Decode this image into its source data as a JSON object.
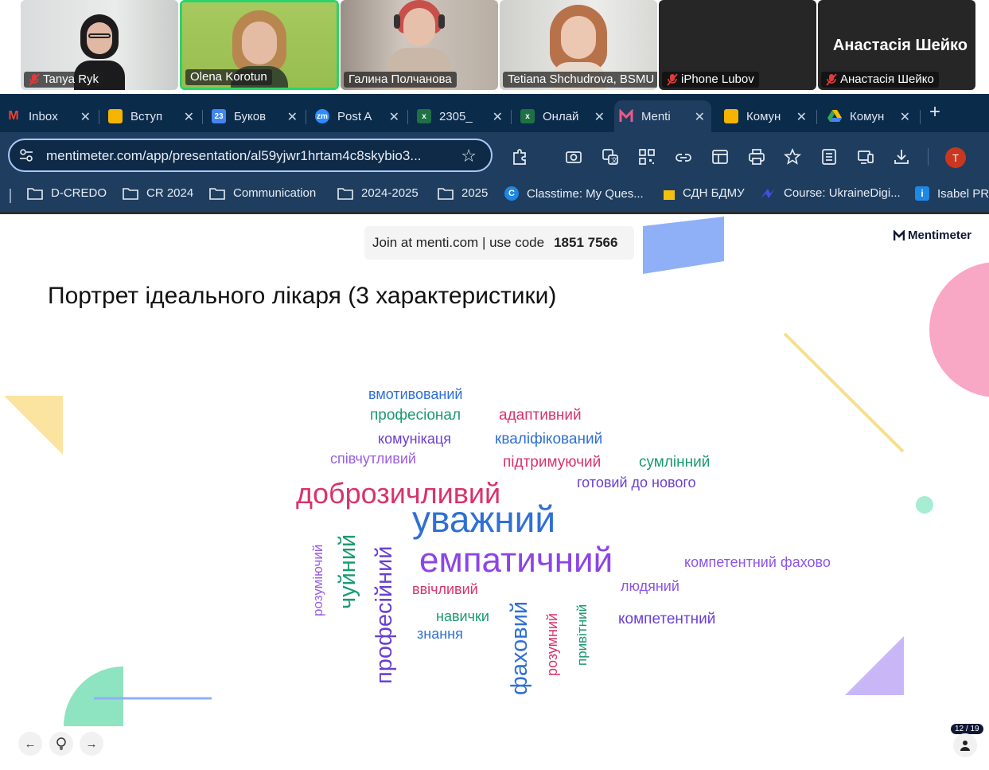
{
  "participants": [
    {
      "name": "Tanya Ryk",
      "muted": true
    },
    {
      "name": "Olena Korotun",
      "muted": false,
      "speaking": true
    },
    {
      "name": "Галина Полчанова",
      "muted": false
    },
    {
      "name": "Tetiana Shchudrova, BSMU",
      "muted": false
    },
    {
      "name": "iPhone Lubov",
      "muted": true
    },
    {
      "name": "Анастасія Шейко",
      "muted": true
    }
  ],
  "featured_name": "Анастасія Шейко",
  "tabs": [
    {
      "label": "Inbox",
      "icon": "gmail-icon",
      "color": "#ea4335"
    },
    {
      "label": "Вступ",
      "icon": "slides-icon",
      "color": "#f4b400"
    },
    {
      "label": "Буков",
      "icon": "calendar-icon",
      "color": "#4285f4"
    },
    {
      "label": "Post A",
      "icon": "zoom-icon",
      "color": "#2d8cff"
    },
    {
      "label": "2305_",
      "icon": "excel-icon",
      "color": "#1e7145"
    },
    {
      "label": "Онлай",
      "icon": "excel-icon",
      "color": "#1e7145"
    },
    {
      "label": "Menti",
      "icon": "mentimeter-icon",
      "color": "#e85c8a"
    },
    {
      "label": "Комун",
      "icon": "slides-icon",
      "color": "#f4b400"
    },
    {
      "label": "Комун",
      "icon": "drive-icon",
      "color": "#34a853"
    }
  ],
  "active_tab": 6,
  "address": {
    "url": "mentimeter.com/app/presentation/al59yjwr1hrtam4c8skybio3..."
  },
  "profile_initial": "T",
  "bookmarks": [
    {
      "label": "D-CREDO",
      "icon": "folder-icon"
    },
    {
      "label": "CR 2024",
      "icon": "folder-icon"
    },
    {
      "label": "Communication",
      "icon": "folder-icon"
    },
    {
      "label": "2024-2025",
      "icon": "folder-icon"
    },
    {
      "label": "2025",
      "icon": "folder-icon"
    },
    {
      "label": "Classtime: My Ques...",
      "icon": "classtime-icon"
    },
    {
      "label": "СДН БДМУ",
      "icon": "sticky-note-icon"
    },
    {
      "label": "Course: UkraineDigi...",
      "icon": "course-icon"
    },
    {
      "label": "Isabel PRO",
      "icon": "isabel-icon"
    }
  ],
  "slide": {
    "join_text": "Join at menti.com | use code",
    "join_code": "1851 7566",
    "brand": "Mentimeter",
    "title": "Портрет ідеального лікаря (3 характеристики)",
    "slide_counter": "12 / 19"
  },
  "word_cloud": [
    {
      "text": "вмотивований",
      "color": "#2f6fd6"
    },
    {
      "text": "професіонал",
      "color": "#1a9a72"
    },
    {
      "text": "адаптивний",
      "color": "#d9336a"
    },
    {
      "text": "комунікаця",
      "color": "#6a3fd2"
    },
    {
      "text": "кваліфікований",
      "color": "#2f6fd6"
    },
    {
      "text": "співчутливий",
      "color": "#9a5ee6"
    },
    {
      "text": "підтримуючий",
      "color": "#d9336a"
    },
    {
      "text": "сумлінний",
      "color": "#1a9a72"
    },
    {
      "text": "готовий до нового",
      "color": "#6a3fd2"
    },
    {
      "text": "доброзичливий",
      "color": "#d9336a"
    },
    {
      "text": "уважний",
      "color": "#2f6fd6"
    },
    {
      "text": "емпатичний",
      "color": "#8b45e6"
    },
    {
      "text": "компетентний фахово",
      "color": "#8b55ea"
    },
    {
      "text": "ввічливий",
      "color": "#d9336a"
    },
    {
      "text": "людяний",
      "color": "#8b55ea"
    },
    {
      "text": "навички",
      "color": "#1a9a72"
    },
    {
      "text": "знання",
      "color": "#2f6fd6"
    },
    {
      "text": "компетентний",
      "color": "#6a3fd2"
    },
    {
      "text": "розуміючий",
      "color": "#9a5ee6"
    },
    {
      "text": "чуйний",
      "color": "#1a9a72"
    },
    {
      "text": "професійний",
      "color": "#6a3fd2"
    },
    {
      "text": "фаховий",
      "color": "#2f6fd6"
    },
    {
      "text": "розумний",
      "color": "#d9336a"
    },
    {
      "text": "привітний",
      "color": "#1a9a72"
    }
  ]
}
